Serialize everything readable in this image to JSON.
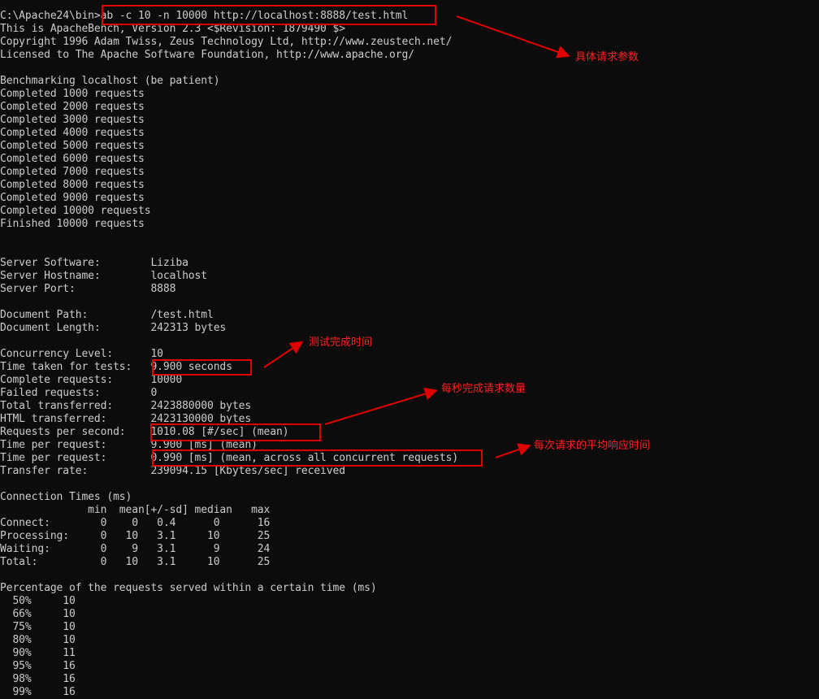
{
  "terminal": {
    "prompt": "C:\\Apache24\\bin>",
    "command": "ab -c 10 -n 10000 http://localhost:8888/test.html",
    "banner": [
      "This is ApacheBench, Version 2.3 <$Revision: 1879490 $>",
      "Copyright 1996 Adam Twiss, Zeus Technology Ltd, http://www.zeustech.net/",
      "Licensed to The Apache Software Foundation, http://www.apache.org/"
    ],
    "progress": [
      "Benchmarking localhost (be patient)",
      "Completed 1000 requests",
      "Completed 2000 requests",
      "Completed 3000 requests",
      "Completed 4000 requests",
      "Completed 5000 requests",
      "Completed 6000 requests",
      "Completed 7000 requests",
      "Completed 8000 requests",
      "Completed 9000 requests",
      "Completed 10000 requests",
      "Finished 10000 requests"
    ],
    "server": [
      "Server Software:        Liziba",
      "Server Hostname:        localhost",
      "Server Port:            8888"
    ],
    "document": [
      "Document Path:          /test.html",
      "Document Length:        242313 bytes"
    ],
    "stats": [
      "Concurrency Level:      10",
      "Time taken for tests:   9.900 seconds",
      "Complete requests:      10000",
      "Failed requests:        0",
      "Total transferred:      2423880000 bytes",
      "HTML transferred:       2423130000 bytes",
      "Requests per second:    1010.08 [#/sec] (mean)",
      "Time per request:       9.900 [ms] (mean)",
      "Time per request:       0.990 [ms] (mean, across all concurrent requests)",
      "Transfer rate:          239094.15 [Kbytes/sec] received"
    ],
    "connection_times": [
      "Connection Times (ms)",
      "              min  mean[+/-sd] median   max",
      "Connect:        0    0   0.4      0      16",
      "Processing:     0   10   3.1     10      25",
      "Waiting:        0    9   3.1      9      24",
      "Total:          0   10   3.1     10      25"
    ],
    "percentages": [
      "Percentage of the requests served within a certain time (ms)",
      "  50%     10",
      "  66%     10",
      "  75%     10",
      "  80%     10",
      "  90%     11",
      "  95%     16",
      "  98%     16",
      "  99%     16"
    ]
  },
  "annotations": {
    "command_params": "具体请求参数",
    "test_time": "测试完成时间",
    "requests_per_second": "每秒完成请求数量",
    "avg_response_time": "每次请求的平均响应时间"
  },
  "colors": {
    "background": "#0c0c0c",
    "text": "#cccccc",
    "annotation": "#e00000"
  }
}
